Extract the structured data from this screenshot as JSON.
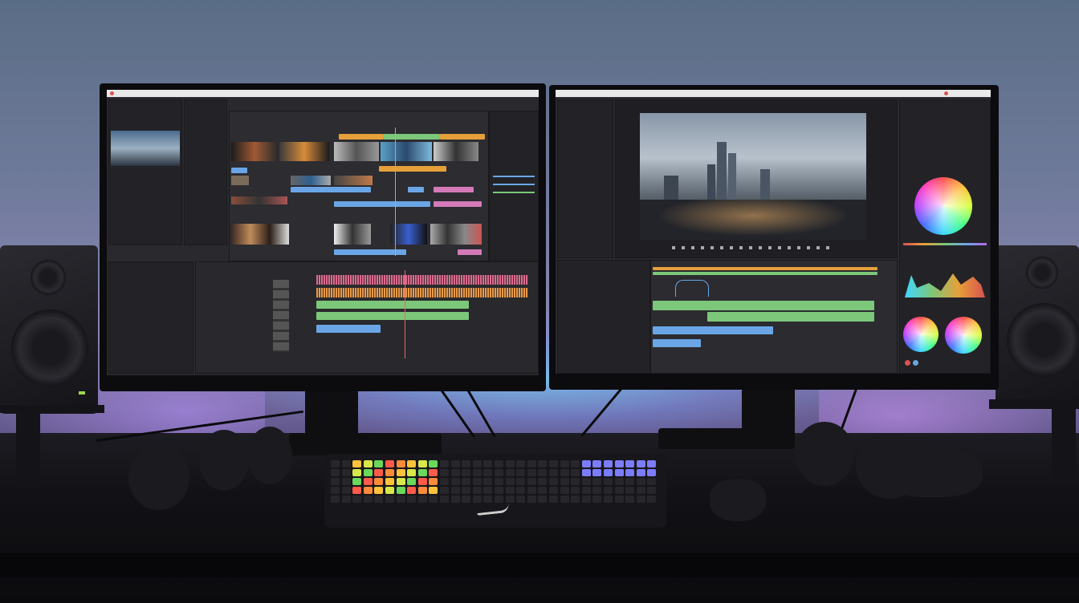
{
  "scene": {
    "description_tag": "dual-monitor-video-editing-desk"
  },
  "colors": {
    "clip_blue": "#6aa6e6",
    "clip_green": "#7cc77a",
    "clip_orange": "#e6a03a",
    "clip_pink": "#d47ab8",
    "wave_pink": "#d96b8f",
    "wave_orange": "#e89a4a",
    "accent_red": "#d9534f"
  },
  "left_monitor": {
    "title_text": "",
    "project_panel_label": "",
    "tools_label": ""
  },
  "right_monitor": {
    "program_label": "",
    "scopes_label": "",
    "color_label": ""
  },
  "keyboard": {
    "logo": "swoosh-logo"
  }
}
